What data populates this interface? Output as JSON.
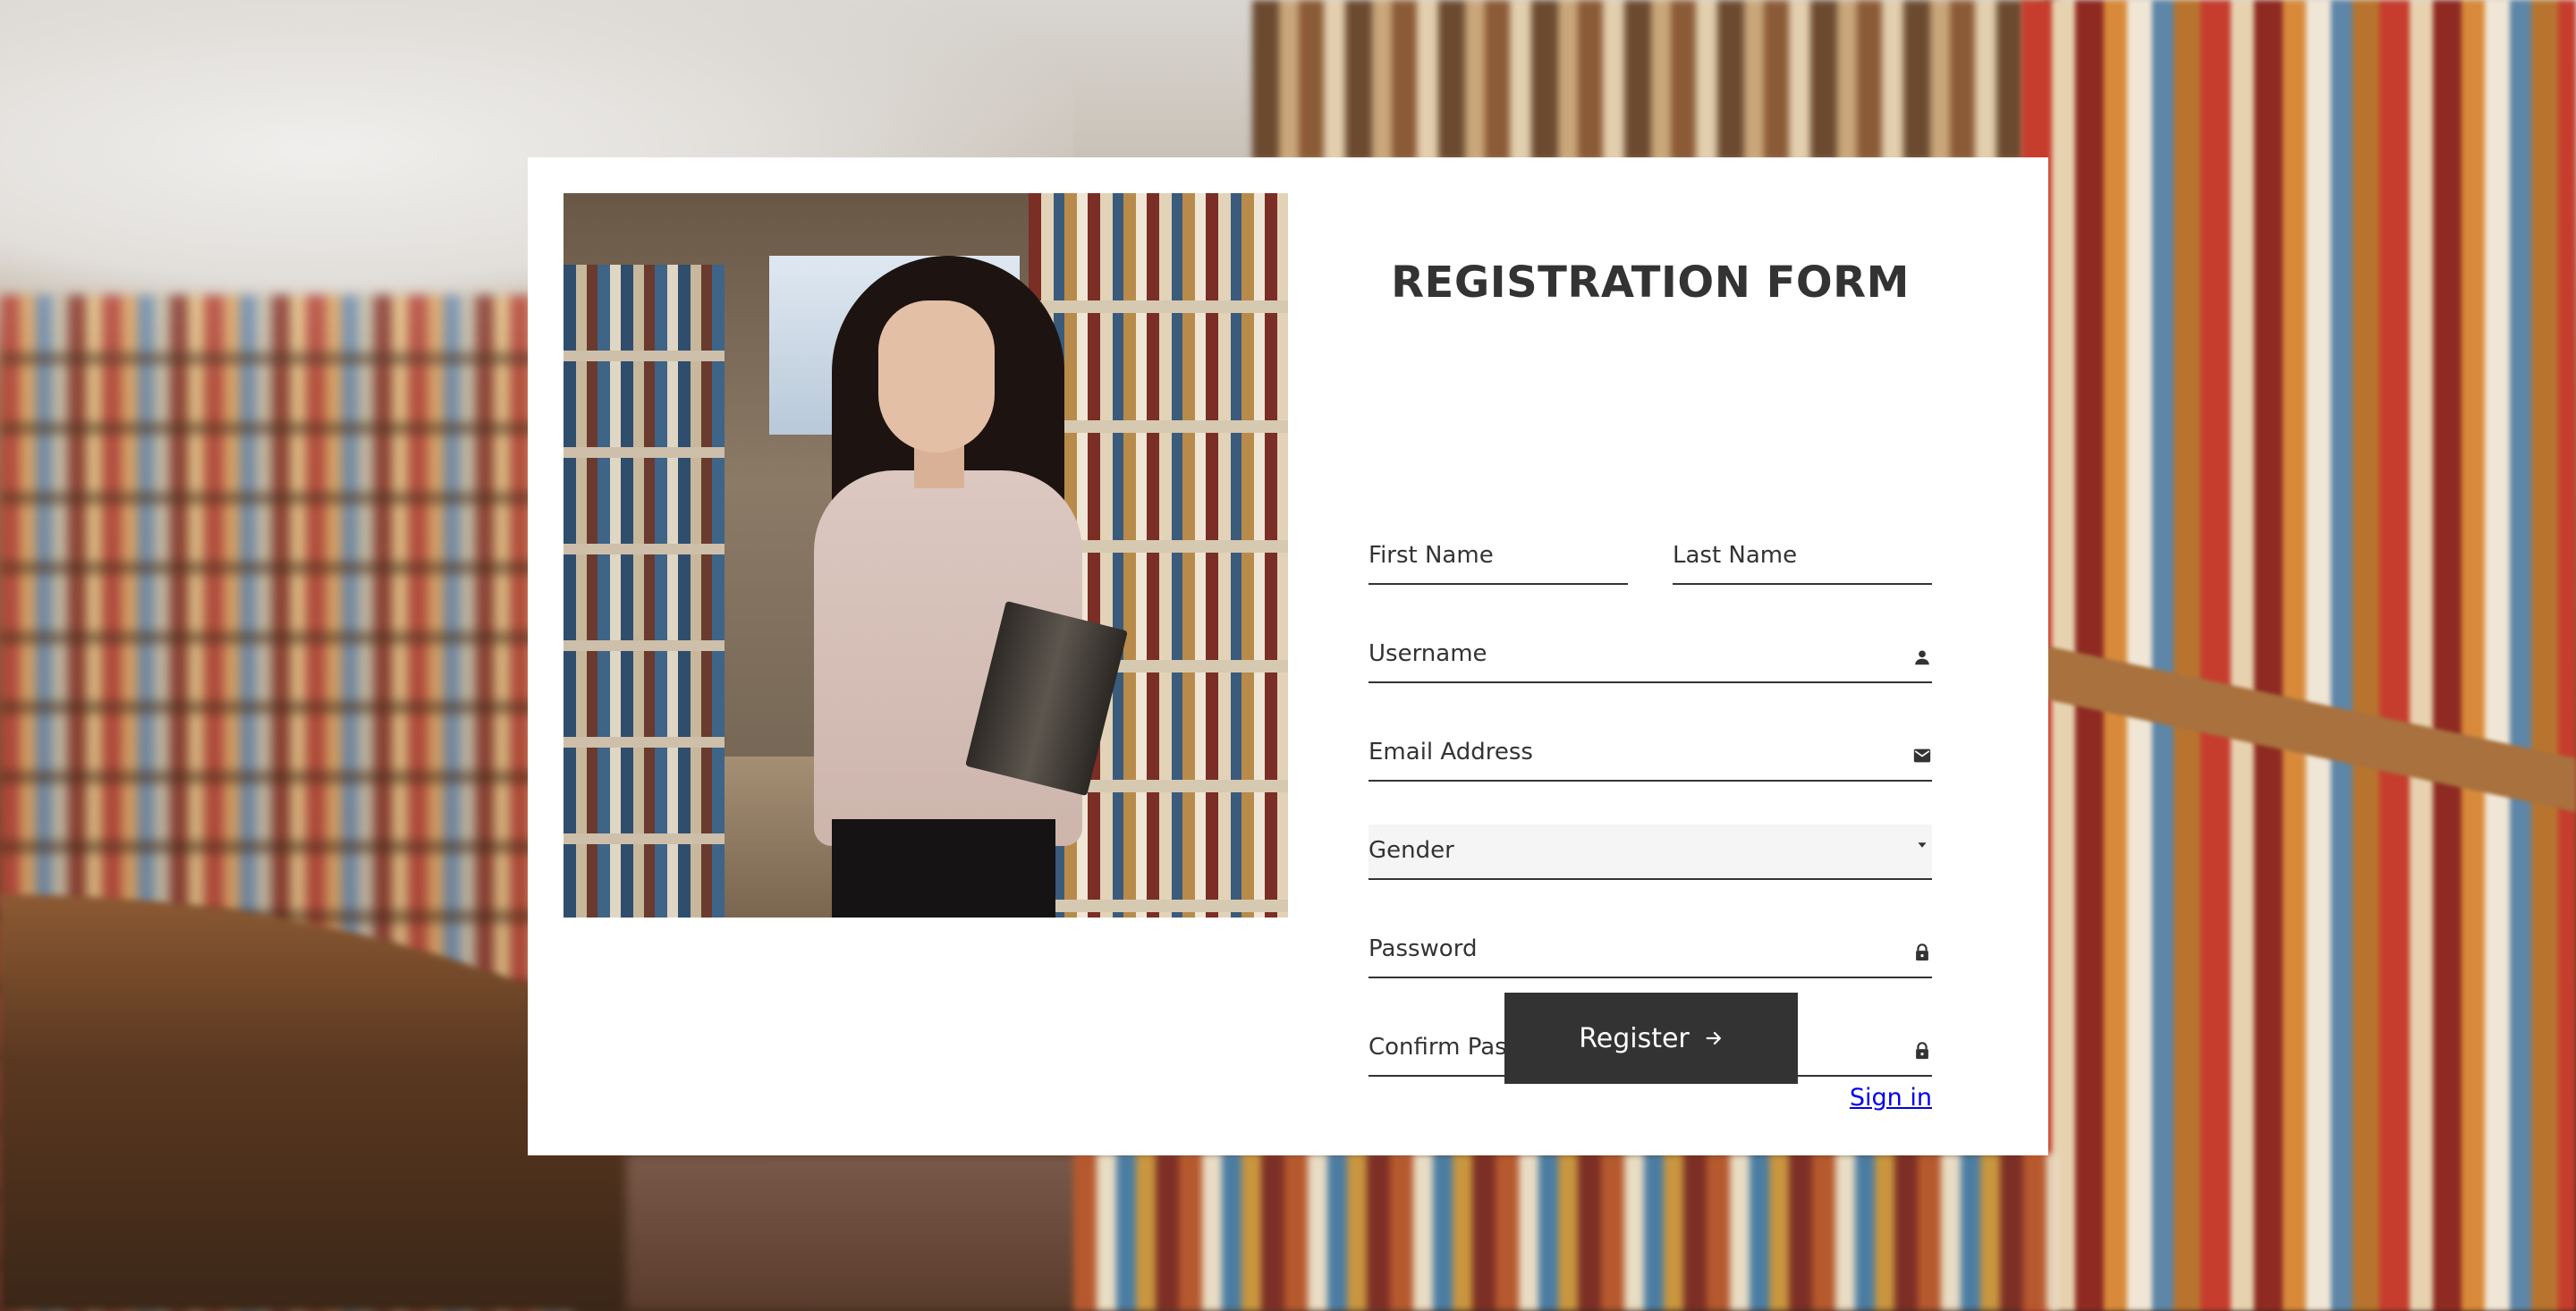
{
  "form": {
    "title": "REGISTRATION FORM",
    "fields": {
      "first_name": {
        "placeholder": "First Name"
      },
      "last_name": {
        "placeholder": "Last Name"
      },
      "username": {
        "placeholder": "Username",
        "icon": "user-icon"
      },
      "email": {
        "placeholder": "Email Address",
        "icon": "mail-icon"
      },
      "gender": {
        "selected": "Gender",
        "icon": "caret-down-icon"
      },
      "password": {
        "placeholder": "Password",
        "icon": "lock-icon"
      },
      "confirm_password": {
        "placeholder": "Confirm Password",
        "icon": "lock-icon"
      }
    },
    "register_label": "Register",
    "register_icon": "arrow-right-icon",
    "signin_label": "Sign in"
  },
  "colors": {
    "primary": "#333333",
    "card": "#ffffff",
    "link": "#0000ee",
    "select_bg": "#f5f5f5"
  }
}
